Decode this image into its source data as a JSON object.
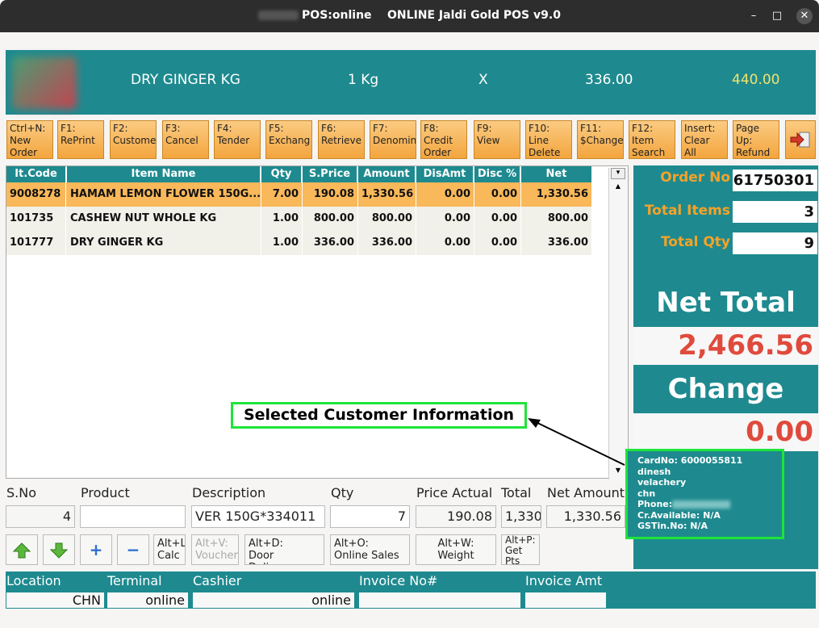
{
  "window": {
    "title": "POS:online    ONLINE Jaldi Gold POS v9.0",
    "minimize": "–",
    "maximize": "□",
    "close": "✕"
  },
  "current_item": {
    "name": "DRY GINGER KG",
    "unit": "1 Kg",
    "x": "X",
    "price": "336.00",
    "amount": "440.00"
  },
  "fkeys": [
    {
      "label": "Ctrl+N:\nNew\nOrder"
    },
    {
      "label": "F1:\nRePrint"
    },
    {
      "label": "F2:\nCustome"
    },
    {
      "label": "F3:\nCancel"
    },
    {
      "label": "F4:\nTender"
    },
    {
      "label": "F5:\nExchang"
    },
    {
      "label": "F6:\nRetrieve"
    },
    {
      "label": "F7:\nDenomin"
    },
    {
      "label": "F8:\nCredit\nOrder"
    },
    {
      "label": "F9:\nView"
    },
    {
      "label": "F10:\nLine\nDelete"
    },
    {
      "label": "F11:\n$Change"
    },
    {
      "label": "F12:\nItem\nSearch"
    },
    {
      "label": "Insert:\nClear All"
    },
    {
      "label": "Page\nUp:\nRefund"
    }
  ],
  "grid": {
    "headers": [
      "It.Code",
      "Item Name",
      "Qty",
      "S.Price",
      "Amount",
      "DisAmt",
      "Disc %",
      "Net Amount"
    ],
    "rows": [
      [
        "9008278",
        "HAMAM LEMON FLOWER 150G...",
        "7.00",
        "190.08",
        "1,330.56",
        "0.00",
        "0.00",
        "1,330.56"
      ],
      [
        "101735",
        "CASHEW NUT WHOLE KG",
        "1.00",
        "800.00",
        "800.00",
        "0.00",
        "0.00",
        "800.00"
      ],
      [
        "101777",
        "DRY GINGER KG",
        "1.00",
        "336.00",
        "336.00",
        "0.00",
        "0.00",
        "336.00"
      ]
    ]
  },
  "summary": {
    "order_no_label": "Order No",
    "order_no": "61750301",
    "total_items_label": "Total Items",
    "total_items": "3",
    "total_qty_label": "Total Qty",
    "total_qty": "9",
    "net_total_label": "Net Total",
    "net_total": "2,466.56",
    "change_label": "Change",
    "change": "0.00"
  },
  "customer": {
    "card": "CardNo: 6000055811",
    "name": "dinesh",
    "area": "velachery",
    "city": "chn",
    "phone": "Phone:",
    "credit": "Cr.Available: N/A",
    "gstin": "GSTin.No: N/A"
  },
  "callout": "Selected Customer Information",
  "line_entry": {
    "sno_label": "S.No",
    "sno": "4",
    "product_label": "Product",
    "product": "",
    "desc_label": "Description",
    "desc": "VER 150G*334011",
    "qty_label": "Qty",
    "qty": "7",
    "price_label": "Price Actual",
    "price": "190.08",
    "total_label": "Total",
    "total": "1,330",
    "net_label": "Net Amount",
    "net": "1,330.56"
  },
  "actions": {
    "calc": "Alt+L:\nCalc",
    "voucher": "Alt+V:\nVoucher",
    "door": "Alt+D:\nDoor Delivery",
    "online": "Alt+O:\nOnline Sales",
    "weight": "Alt+W:\nWeight",
    "points": "Alt+P:\nGet\nPts"
  },
  "footer": {
    "location_label": "Location",
    "location": "CHN",
    "terminal_label": "Terminal",
    "terminal": "online",
    "cashier_label": "Cashier",
    "cashier": "online",
    "invoice_label": "Invoice No#",
    "invoice": "",
    "invamt_label": "Invoice Amt",
    "invamt": ""
  },
  "colors": {
    "teal": "#1e8a8f",
    "orange": "#f5a227",
    "red": "#e04a3c",
    "highlight": "#1ee43a"
  }
}
